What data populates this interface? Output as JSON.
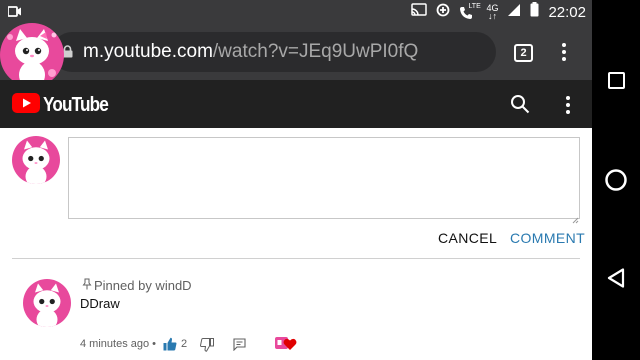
{
  "status_bar": {
    "time": "22:02",
    "lte": "LTE",
    "network": "4G"
  },
  "browser": {
    "url_host": "m.youtube.com",
    "url_path": "/watch?v=JEq9UwPI0fQ",
    "tab_count": "2"
  },
  "youtube": {
    "logo_text": "YouTube"
  },
  "comment_form": {
    "cancel_label": "CANCEL",
    "comment_label": "COMMENT",
    "input_value": ""
  },
  "pinned_comment": {
    "pinned_label": "Pinned by windD",
    "text": "DDraw",
    "time": "4 minutes ago",
    "separator": "•",
    "like_count": "2"
  },
  "colors": {
    "accent_blue": "#2a7ab0",
    "youtube_red": "#ff0000",
    "header_bg": "#212121",
    "chrome_bg": "#3a3a3c"
  }
}
